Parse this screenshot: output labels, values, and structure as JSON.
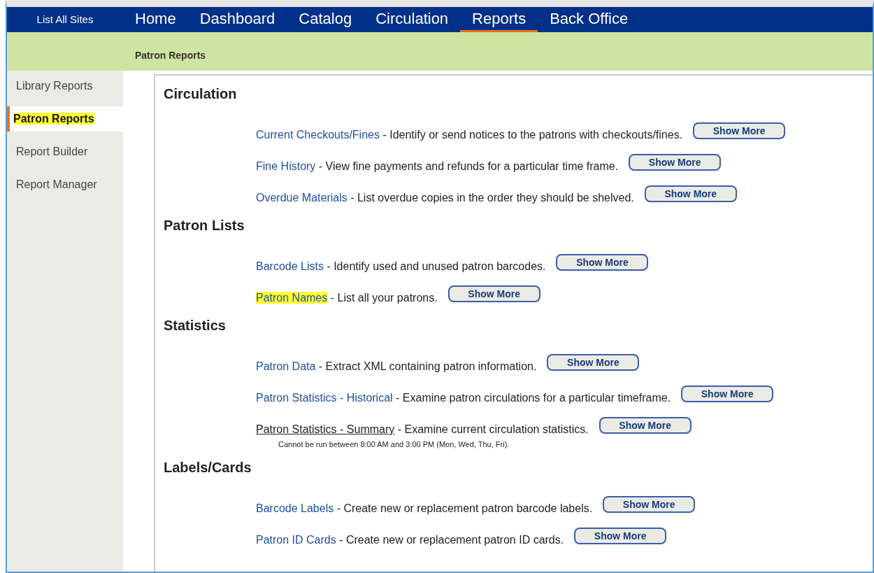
{
  "site_link": "List All Sites",
  "nav": [
    {
      "label": "Home",
      "selected": false
    },
    {
      "label": "Dashboard",
      "selected": false
    },
    {
      "label": "Catalog",
      "selected": false
    },
    {
      "label": "Circulation",
      "selected": false
    },
    {
      "label": "Reports",
      "selected": true
    },
    {
      "label": "Back Office",
      "selected": false
    }
  ],
  "breadcrumb": "Patron Reports",
  "sidebar": {
    "items": [
      {
        "label": "Library Reports",
        "selected": false,
        "highlighted": false
      },
      {
        "label": "Patron Reports",
        "selected": true,
        "highlighted": true
      },
      {
        "label": "Report Builder",
        "selected": false,
        "highlighted": false
      },
      {
        "label": "Report Manager",
        "selected": false,
        "highlighted": false
      }
    ]
  },
  "sections": [
    {
      "title": "Circulation",
      "reports": [
        {
          "link": "Current Checkouts/Fines",
          "description": " - Identify or send notices to the patrons with checkouts/fines.",
          "button": "Show More",
          "highlighted": false,
          "underlined": false
        },
        {
          "link": "Fine History",
          "description": " - View fine payments and refunds for a particular time frame.",
          "button": "Show More",
          "highlighted": false,
          "underlined": false
        },
        {
          "link": "Overdue Materials",
          "description": " - List overdue copies in the order they should be shelved.",
          "button": "Show More",
          "highlighted": false,
          "underlined": false
        }
      ]
    },
    {
      "title": "Patron Lists",
      "reports": [
        {
          "link": "Barcode Lists",
          "description": " - Identify used and unused patron barcodes.",
          "button": "Show More",
          "highlighted": false,
          "underlined": false
        },
        {
          "link": "Patron Names",
          "description": " - List all your patrons.",
          "button": "Show More",
          "highlighted": true,
          "underlined": false
        }
      ]
    },
    {
      "title": "Statistics",
      "reports": [
        {
          "link": "Patron Data",
          "description": " - Extract XML containing patron information.",
          "button": "Show More",
          "highlighted": false,
          "underlined": false
        },
        {
          "link": "Patron Statistics - Historical",
          "description": " - Examine patron circulations for a particular timeframe.",
          "button": "Show More",
          "highlighted": false,
          "underlined": false
        },
        {
          "link": "Patron Statistics - Summary",
          "description": " - Examine current circulation statistics.",
          "button": "Show More",
          "highlighted": false,
          "underlined": true,
          "note": "Cannot be run between 8:00 AM and 3:00 PM (Mon, Wed, Thu, Fri)."
        }
      ]
    },
    {
      "title": "Labels/Cards",
      "reports": [
        {
          "link": "Barcode Labels",
          "description": " - Create new or replacement patron barcode labels.",
          "button": "Show More",
          "highlighted": false,
          "underlined": false
        },
        {
          "link": "Patron ID Cards",
          "description": " - Create new or replacement patron ID cards.",
          "button": "Show More",
          "highlighted": false,
          "underlined": false
        }
      ]
    }
  ]
}
